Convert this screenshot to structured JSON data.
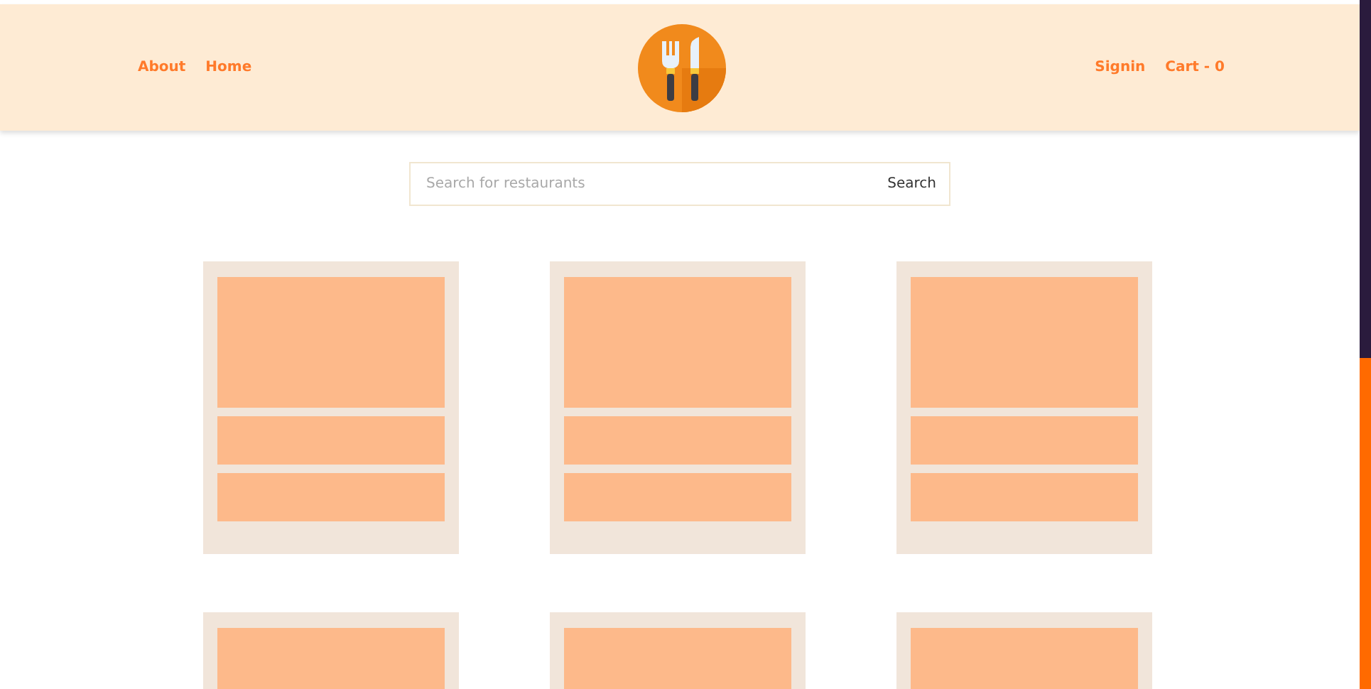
{
  "header": {
    "left_links": [
      "About",
      "Home"
    ],
    "right_links": [
      "Signin",
      "Cart - 0"
    ]
  },
  "search": {
    "placeholder": "Search for restaurants",
    "button": "Search"
  },
  "cards": [
    {
      "kind": "placeholder"
    },
    {
      "kind": "placeholder"
    },
    {
      "kind": "placeholder"
    },
    {
      "kind": "cut"
    },
    {
      "kind": "cut"
    },
    {
      "kind": "cut"
    }
  ]
}
